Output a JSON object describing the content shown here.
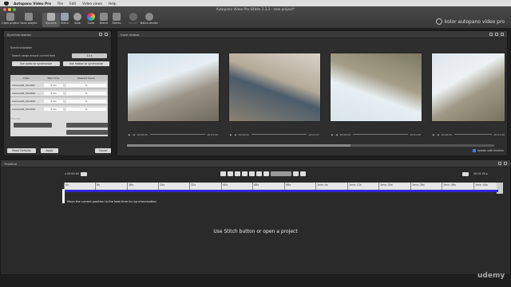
{
  "menubar": {
    "app": "Autopano Video Pro",
    "items": [
      "File",
      "Edit",
      "Video views",
      "Help"
    ]
  },
  "window": {
    "title": "Autopano Video Pro 64bits 2.3.3 - new project*"
  },
  "toolbar": [
    {
      "label": "Open project",
      "icon": "folder-icon",
      "color": "#8a8a8a"
    },
    {
      "label": "Save project",
      "icon": "save-icon",
      "color": "#8a8a8a"
    },
    {
      "label": "Synchro",
      "icon": "synchro-icon",
      "color": "#b0b0b0",
      "active": true
    },
    {
      "label": "Stitch",
      "icon": "stitch-icon",
      "color": "#9aa0aa"
    },
    {
      "label": "Stab",
      "icon": "stab-icon",
      "color": "#a0a0a0"
    },
    {
      "label": "Color",
      "icon": "color-icon",
      "color": "#d9a020"
    },
    {
      "label": "Blend",
      "icon": "blend-icon",
      "color": "#8a8a8a"
    },
    {
      "label": "Stereo",
      "icon": "stereo-icon",
      "color": "#8a8a8a"
    },
    {
      "label": "Render",
      "icon": "render-icon",
      "color": "#6a6a6a",
      "disabled": true
    },
    {
      "label": "Batch render",
      "icon": "batch-render-icon",
      "color": "#8a8a8a"
    }
  ],
  "brand": {
    "name": "kolor autopano video pro"
  },
  "sync_panel": {
    "title": "Synchronization",
    "section": "Synchronization",
    "range_label": "Search range around current time",
    "range_value": "10 s",
    "use_audio": "Use audio to synchronize",
    "use_motion": "Use motion to synchronize",
    "columns": [
      "Video",
      "Start time",
      "Nearest frame"
    ],
    "rows": [
      {
        "video": "Camera01_Short01",
        "start": "0 ms",
        "frame": "0"
      },
      {
        "video": "Camera02_Short02",
        "start": "0 ms",
        "frame": "0"
      },
      {
        "video": "Camera03_Short03",
        "start": "0 ms",
        "frame": "0"
      },
      {
        "video": "Camera04_Short04",
        "start": "0 ms",
        "frame": "0"
      }
    ],
    "preview_label": "Preview",
    "reset_btn": "Reset Defaults",
    "apply_btn": "Apply",
    "cancel_btn": "Cancel"
  },
  "input_panel": {
    "title": "Input videos",
    "videos": [
      {
        "start": "00:00:00",
        "end": "00:01:00"
      },
      {
        "start": "00:00:00",
        "end": "00:01:07"
      },
      {
        "start": "00:00:00",
        "end": "00:01:06"
      },
      {
        "start": "00:00:00",
        "end": "00:01:00"
      }
    ],
    "update_label": "Update with timeline"
  },
  "timeline": {
    "title": "Timeline",
    "left_time": "00:00:00",
    "right_time": "00:01:00",
    "ticks": [
      "0s",
      "8s",
      "16s",
      "24s",
      "32s",
      "40s",
      "48s",
      "56s",
      "1min 4s",
      "1min 12s",
      "1min 20s",
      "1min 28s",
      "1min 36s",
      "1min 44s"
    ],
    "hint": "Move the current position to the best time for synchronization",
    "empty_message": "Use Stitch button or open a project"
  },
  "watermark": "udemy"
}
